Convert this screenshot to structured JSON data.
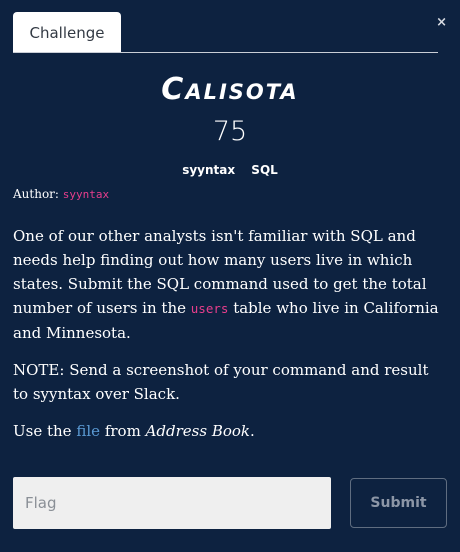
{
  "modal": {
    "close_glyph": "×",
    "tab_label": "Challenge"
  },
  "challenge": {
    "name": "Calisota",
    "value": "75",
    "tags": [
      "syyntax",
      "SQL"
    ],
    "author_label": "Author:",
    "author_name": "syyntax"
  },
  "description": {
    "p1_pre": "One of our other analysts isn't familiar with SQL and needs help finding out how many users live in which states. Submit the SQL command used to get the total number of users in the",
    "p1_code": "users",
    "p1_post": "table who live in California and Minnesota.",
    "p2": "NOTE: Send a screenshot of your command and result to syyntax over Slack.",
    "p3_pre": "Use the",
    "p3_link": "file",
    "p3_mid": "from",
    "p3_em": "Address Book",
    "p3_post": "."
  },
  "form": {
    "flag_placeholder": "Flag",
    "flag_value": "",
    "submit_label": "Submit"
  }
}
